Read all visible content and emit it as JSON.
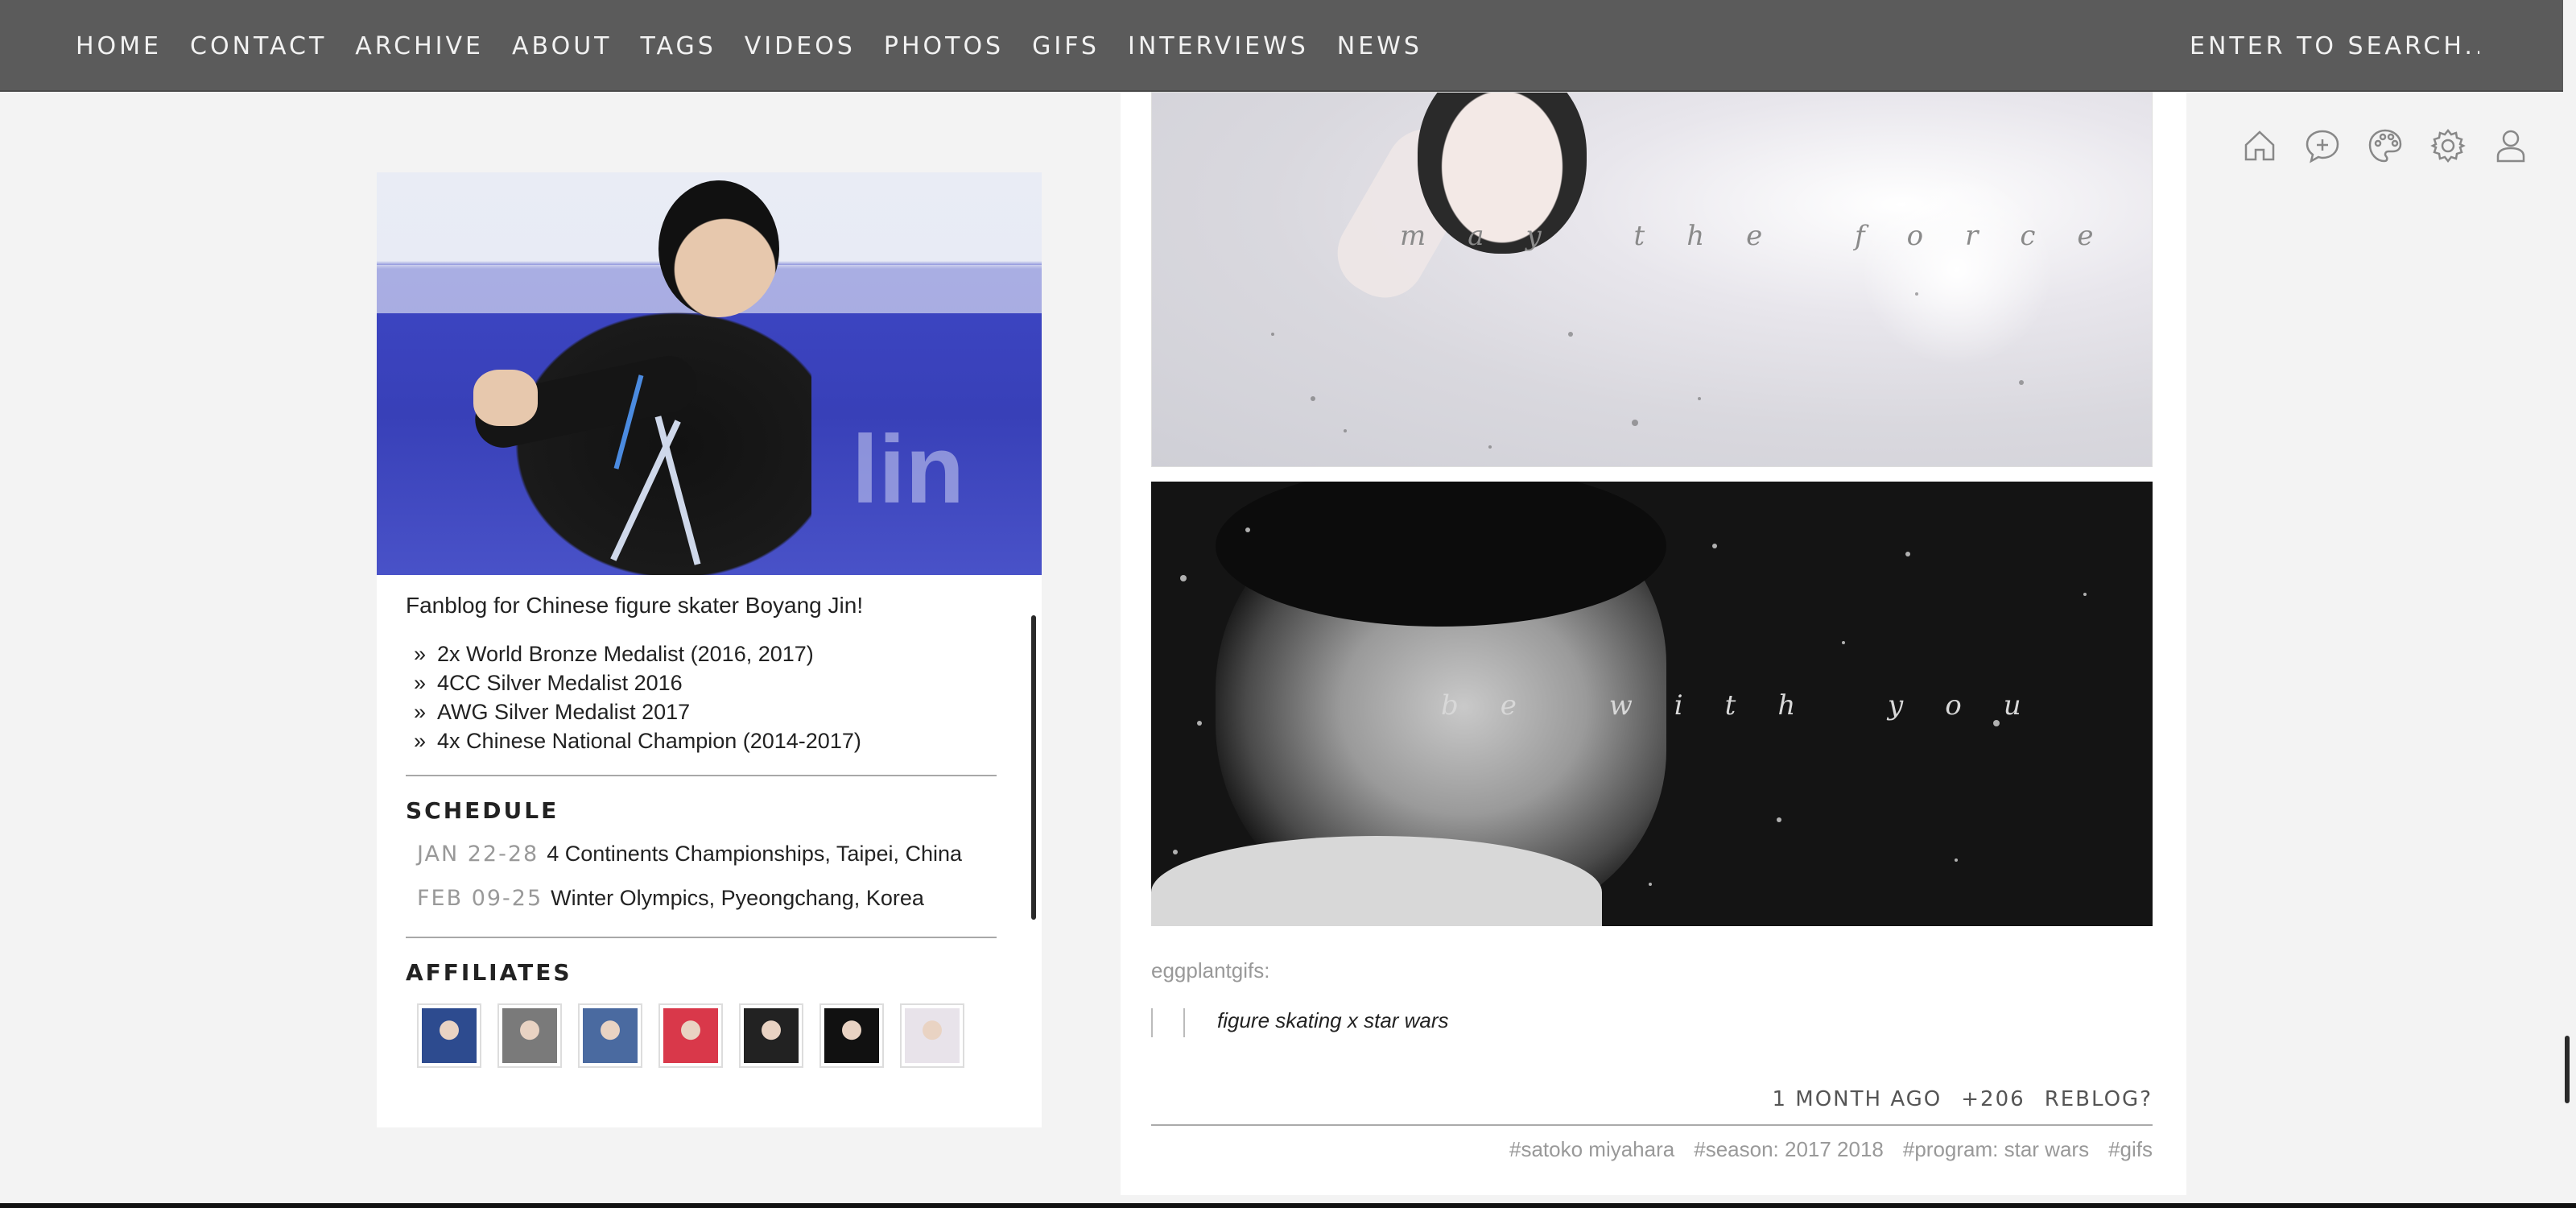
{
  "nav": {
    "items": [
      "HOME",
      "CONTACT",
      "ARCHIVE",
      "ABOUT",
      "TAGS",
      "VIDEOS",
      "PHOTOS",
      "GIFS",
      "INTERVIEWS",
      "NEWS"
    ],
    "search_placeholder": "ENTER TO SEARCH..."
  },
  "sidebar": {
    "description": "Fanblog for Chinese figure skater Boyang Jin!",
    "bullet": "»",
    "facts": [
      "2x World Bronze Medalist (2016, 2017)",
      "4CC Silver Medalist 2016",
      "AWG Silver Medalist 2017",
      "4x Chinese National Champion (2014-2017)"
    ],
    "schedule_title": "SCHEDULE",
    "schedule": [
      {
        "date": "JAN 22-28",
        "event": "4 Continents Championships, Taipei, China"
      },
      {
        "date": "FEB 09-25",
        "event": "Winter Olympics, Pyeongchang, Korea"
      }
    ],
    "affiliates_title": "AFFILIATES",
    "affiliate_colors": [
      "#2d4b8f",
      "#7a7a7a",
      "#4a6aa0",
      "#d9384a",
      "#222222",
      "#111111",
      "#e8e3ea"
    ]
  },
  "post": {
    "gif1_caption": "may the force",
    "gif2_caption": "be with you",
    "reblog_source": "eggplantgifs",
    "reblog_colon": ":",
    "quote": "figure skating x star wars",
    "time": "1 MONTH AGO",
    "notes": "+206",
    "reblog": "REBLOG?",
    "tags": [
      "#satoko miyahara",
      "#season: 2017 2018",
      "#program: star wars",
      "#gifs"
    ]
  },
  "icons": [
    "home-icon",
    "new-post-icon",
    "palette-icon",
    "settings-icon",
    "account-icon"
  ],
  "colors": {
    "topbar": "#5b5b5b",
    "background": "#f3f3f3",
    "muted_text": "#999999"
  }
}
